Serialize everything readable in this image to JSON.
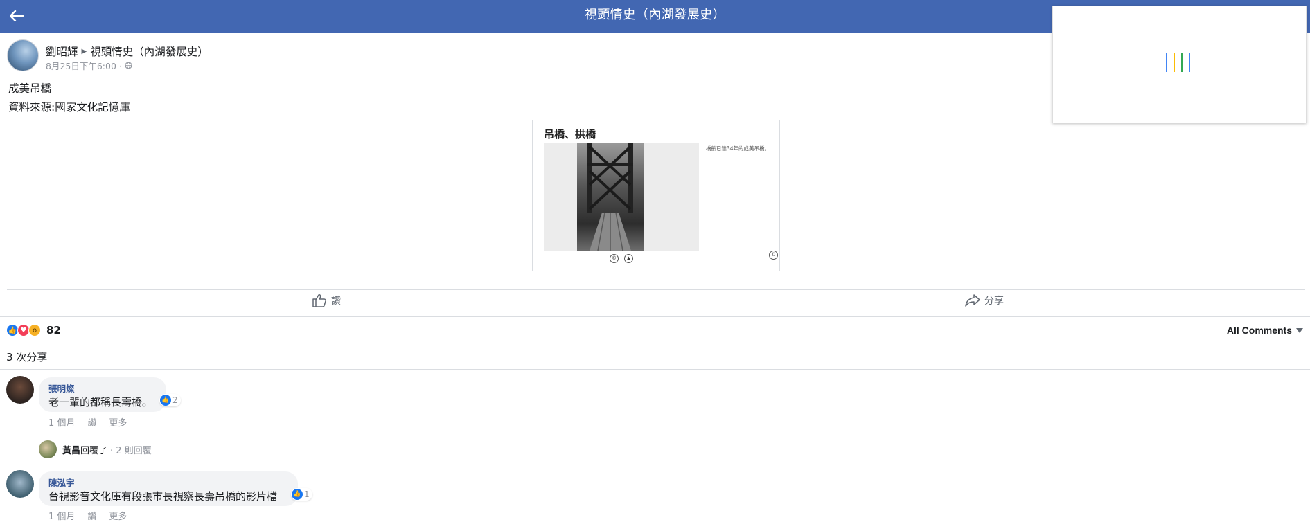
{
  "header": {
    "title": "視頭情史（內湖發展史）",
    "back_icon": "back-arrow-icon",
    "bg_color": "#4267b2"
  },
  "post": {
    "author": "劉昭輝",
    "group": "視頭情史（內湖發展史）",
    "timestamp": "8月25日下午6:00 ·",
    "lines": [
      "成美吊橋",
      "資料來源:國家文化記憶庫"
    ],
    "media": {
      "title": "吊橋、拱橋",
      "caption": "橋齡已達34年的成美吊橋。"
    }
  },
  "actions": {
    "like": "讚",
    "share": "分享"
  },
  "stats": {
    "reaction_count": "82",
    "reaction_icons": [
      "like-icon",
      "love-icon",
      "wow-icon"
    ],
    "shares": "3 次分享",
    "sort_label": "All Comments"
  },
  "comments": [
    {
      "name": "張明燦",
      "text": "老一輩的都稱長壽橋。",
      "likes": "2",
      "meta": [
        "1 個月",
        "讚",
        "更多"
      ]
    },
    {
      "name": "陳泓宇",
      "text": "台視影音文化庫有段張市長視察長壽吊橋的影片檔",
      "likes": "1",
      "meta": [
        "1 個月",
        "讚",
        "更多"
      ]
    }
  ],
  "reply": {
    "name": "黃昌",
    "action": "回覆了",
    "count": "· 2 則回覆"
  },
  "loader_colors": [
    "#4285f4",
    "#fbbc05",
    "#34a853",
    "#4285f4"
  ]
}
